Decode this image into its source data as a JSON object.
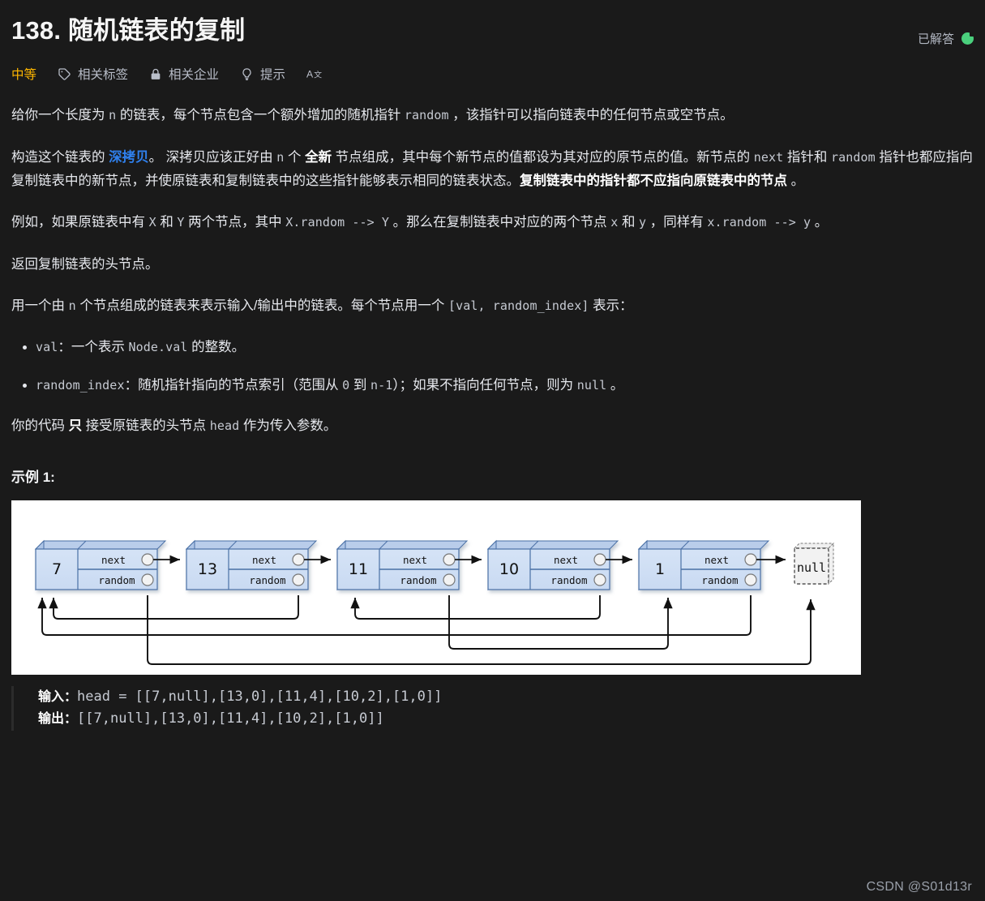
{
  "header": {
    "title": "138. 随机链表的复制",
    "status_label": "已解答",
    "status_color": "#4ad07d"
  },
  "toolbar": {
    "difficulty": "中等",
    "difficulty_color": "#ffb700",
    "items": [
      {
        "icon": "tag-icon",
        "label": "相关标签"
      },
      {
        "icon": "lock-icon",
        "label": "相关企业"
      },
      {
        "icon": "lightbulb-icon",
        "label": "提示"
      },
      {
        "icon": "translate-icon",
        "label": ""
      }
    ]
  },
  "content": {
    "p1_a": "给你一个长度为 ",
    "p1_code1": "n",
    "p1_b": " 的链表，每个节点包含一个额外增加的随机指针 ",
    "p1_code2": "random",
    "p1_c": " ，该指针可以指向链表中的任何节点或空节点。",
    "p2_a": "构造这个链表的 ",
    "p2_link": "深拷贝",
    "p2_b": "。 深拷贝应该正好由 ",
    "p2_code1": "n",
    "p2_c": " 个 ",
    "p2_bold1": "全新",
    "p2_d": " 节点组成，其中每个新节点的值都设为其对应的原节点的值。新节点的 ",
    "p2_code2": "next",
    "p2_e": " 指针和 ",
    "p2_code3": "random",
    "p2_f": " 指针也都应指向复制链表中的新节点，并使原链表和复制链表中的这些指针能够表示相同的链表状态。",
    "p2_bold2": "复制链表中的指针都不应指向原链表中的节点",
    "p2_g": " 。",
    "p3_a": "例如，如果原链表中有 ",
    "p3_code1": "X",
    "p3_b": " 和 ",
    "p3_code2": "Y",
    "p3_c": " 两个节点，其中 ",
    "p3_code3": "X.random --> Y",
    "p3_d": " 。那么在复制链表中对应的两个节点 ",
    "p3_code4": "x",
    "p3_e": " 和 ",
    "p3_code5": "y",
    "p3_f": " ，同样有 ",
    "p3_code6": "x.random --> y",
    "p3_g": " 。",
    "p4": "返回复制链表的头节点。",
    "p5_a": "用一个由 ",
    "p5_code1": "n",
    "p5_b": " 个节点组成的链表来表示输入/输出中的链表。每个节点用一个 ",
    "p5_code2": "[val, random_index]",
    "p5_c": " 表示：",
    "li1_code": "val",
    "li1_a": "：一个表示 ",
    "li1_code2": "Node.val",
    "li1_b": " 的整数。",
    "li2_code": "random_index",
    "li2_a": "：随机指针指向的节点索引（范围从 ",
    "li2_code2": "0",
    "li2_b": " 到 ",
    "li2_code3": "n-1",
    "li2_c": "）；如果不指向任何节点，则为 ",
    "li2_code4": "null",
    "li2_d": " 。",
    "p6_a": "你的代码 ",
    "p6_bold": "只",
    "p6_b": " 接受原链表的头节点 ",
    "p6_code": "head",
    "p6_c": " 作为传入参数。"
  },
  "example": {
    "title": "示例 1:",
    "input_label": "输入：",
    "input_value": "head = [[7,null],[13,0],[11,4],[10,2],[1,0]]",
    "output_label": "输出：",
    "output_value": "[[7,null],[13,0],[11,4],[10,2],[1,0]]"
  },
  "diagram": {
    "next_label": "next",
    "random_label": "random",
    "null_label": "null",
    "node_face_color": "#cfdef2",
    "node_border_color": "#4a6fa5",
    "nodes": [
      {
        "val": "7",
        "random_target": "null"
      },
      {
        "val": "13",
        "random_target": "0"
      },
      {
        "val": "11",
        "random_target": "4"
      },
      {
        "val": "10",
        "random_target": "2"
      },
      {
        "val": "1",
        "random_target": "0"
      }
    ]
  },
  "watermark": "CSDN @S01d13r"
}
